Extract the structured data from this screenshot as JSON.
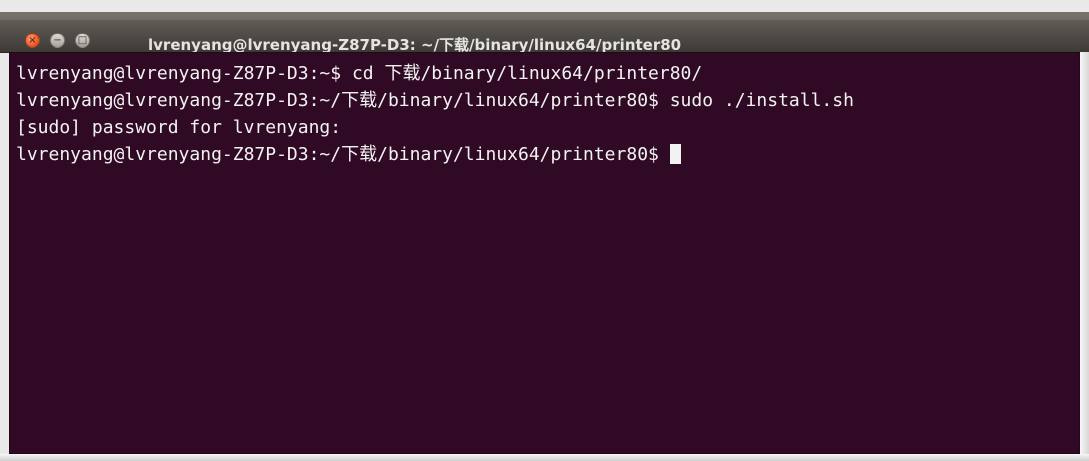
{
  "window": {
    "title": "lvrenyang@lvrenyang-Z87P-D3: ~/下载/binary/linux64/printer80",
    "buttons": {
      "close_symbol": "×",
      "minimize_symbol": "−",
      "maximize_symbol": "□"
    }
  },
  "terminal": {
    "lines": [
      "lvrenyang@lvrenyang-Z87P-D3:~$ cd 下载/binary/linux64/printer80/",
      "lvrenyang@lvrenyang-Z87P-D3:~/下载/binary/linux64/printer80$ sudo ./install.sh",
      "[sudo] password for lvrenyang:",
      "lvrenyang@lvrenyang-Z87P-D3:~/下载/binary/linux64/printer80$ "
    ],
    "colors": {
      "background": "#300a24",
      "text": "#f3f3f3",
      "cursor": "#f2f2f2"
    }
  }
}
